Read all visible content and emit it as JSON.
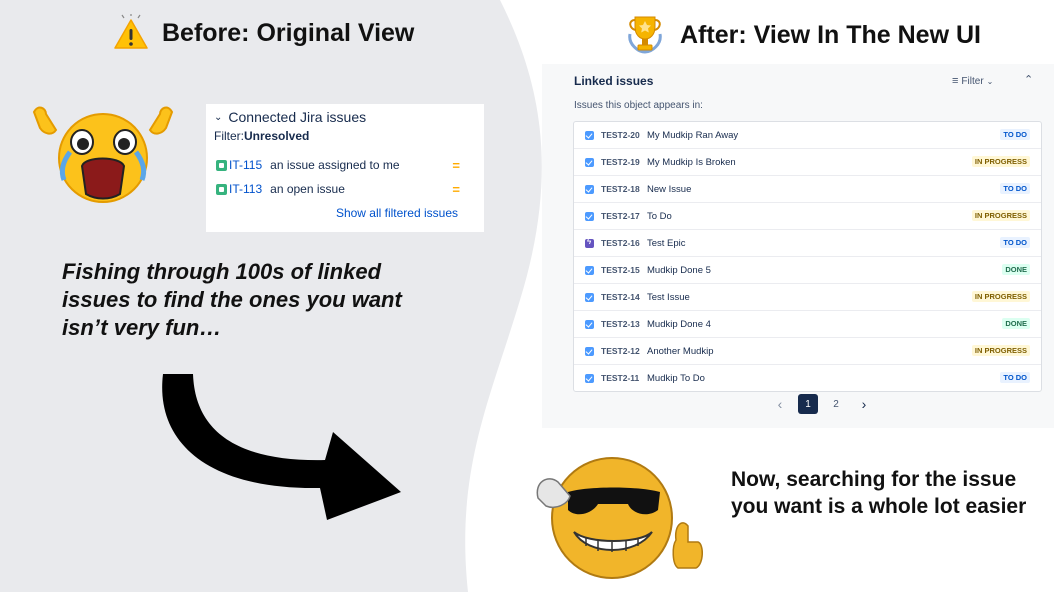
{
  "left_heading": "Before: Original View",
  "right_heading": "After: View In The New UI",
  "old_panel": {
    "title": "Connected Jira issues",
    "filter_label": "Filter:",
    "filter_value": "Unresolved",
    "issues": [
      {
        "key": "IT-115",
        "summary": "an issue assigned to me",
        "priority": "="
      },
      {
        "key": "IT-113",
        "summary": "an open issue",
        "priority": "="
      }
    ],
    "show_all_link": "Show all filtered issues"
  },
  "left_caption": "Fishing through 100s of linked issues to find the ones you want isn’t very fun…",
  "new_panel": {
    "title": "Linked issues",
    "filter_label": "Filter",
    "subtitle": "Issues this object appears in:",
    "issues": [
      {
        "key": "TEST2-20",
        "summary": "My Mudkip Ran Away",
        "status": "TO DO",
        "type": "task"
      },
      {
        "key": "TEST2-19",
        "summary": "My Mudkip Is Broken",
        "status": "IN PROGRESS",
        "type": "task"
      },
      {
        "key": "TEST2-18",
        "summary": "New Issue",
        "status": "TO DO",
        "type": "task"
      },
      {
        "key": "TEST2-17",
        "summary": "To Do",
        "status": "IN PROGRESS",
        "type": "task"
      },
      {
        "key": "TEST2-16",
        "summary": "Test Epic",
        "status": "TO DO",
        "type": "epic"
      },
      {
        "key": "TEST2-15",
        "summary": "Mudkip Done 5",
        "status": "DONE",
        "type": "task"
      },
      {
        "key": "TEST2-14",
        "summary": "Test Issue",
        "status": "IN PROGRESS",
        "type": "task"
      },
      {
        "key": "TEST2-13",
        "summary": "Mudkip Done 4",
        "status": "DONE",
        "type": "task"
      },
      {
        "key": "TEST2-12",
        "summary": "Another Mudkip",
        "status": "IN PROGRESS",
        "type": "task"
      },
      {
        "key": "TEST2-11",
        "summary": "Mudkip To Do",
        "status": "TO DO",
        "type": "task"
      }
    ],
    "pagination": {
      "prev": "‹",
      "pages": [
        "1",
        "2"
      ],
      "current": "1",
      "next": "›"
    }
  },
  "right_caption": "Now, searching for the issue you want is a whole lot easier",
  "colors": {
    "left_bg": "#e9eaed",
    "todo": "#0055cc",
    "in_progress": "#7f5f01",
    "done": "#216e4e"
  }
}
